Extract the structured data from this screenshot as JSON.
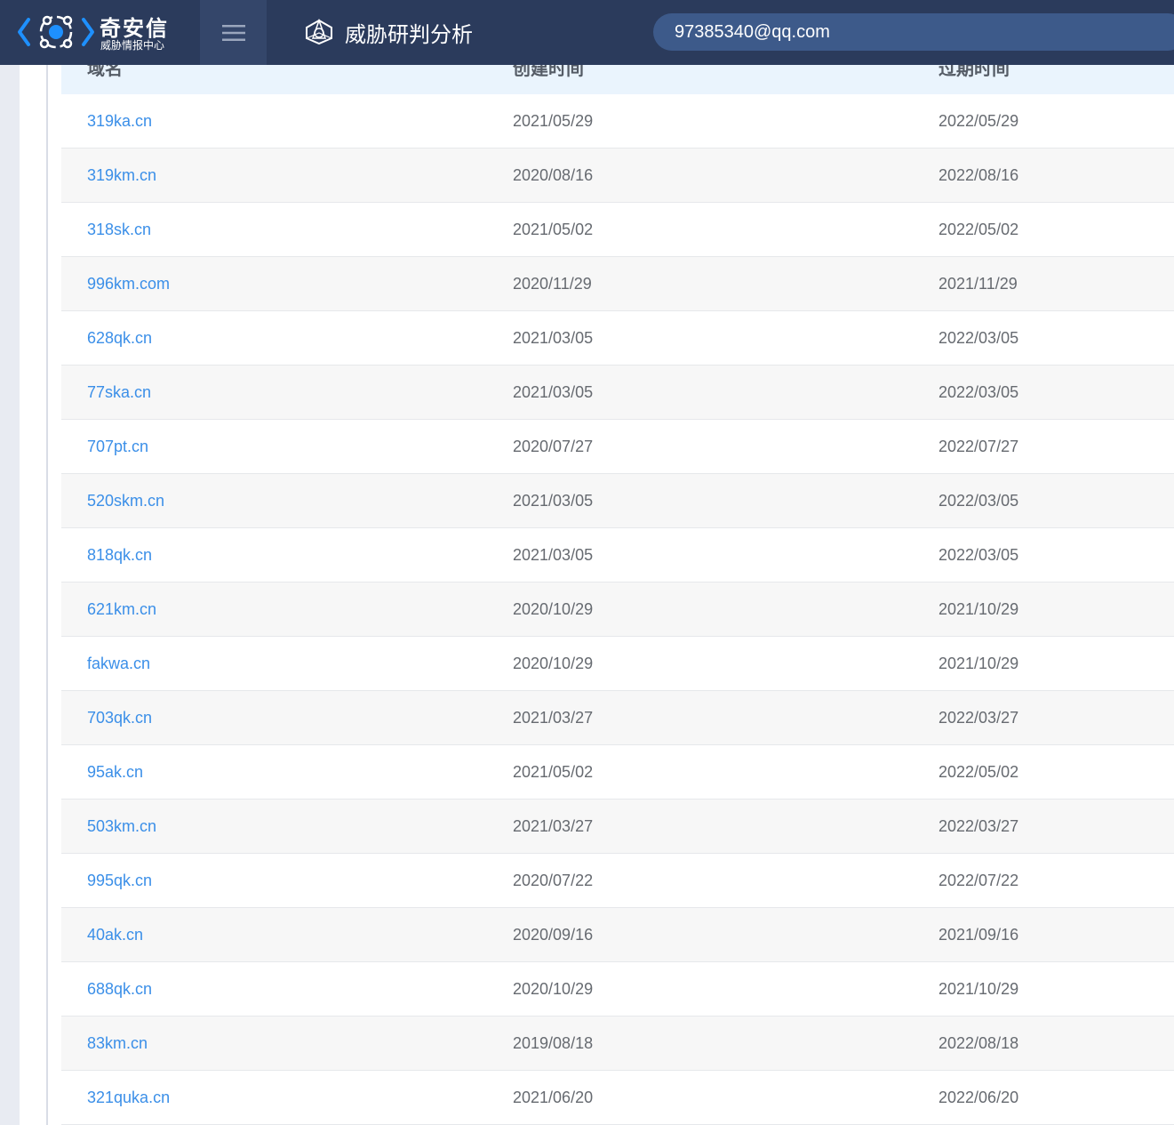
{
  "header": {
    "logo_title": "奇安信",
    "logo_subtitle": "威胁情报中心",
    "page_title": "威胁研判分析",
    "search_value": "97385340@qq.com"
  },
  "table": {
    "columns": [
      "域名",
      "创建时间",
      "过期时间"
    ],
    "rows": [
      {
        "domain": "319ka.cn",
        "created": "2021/05/29",
        "expires": "2022/05/29"
      },
      {
        "domain": "319km.cn",
        "created": "2020/08/16",
        "expires": "2022/08/16"
      },
      {
        "domain": "318sk.cn",
        "created": "2021/05/02",
        "expires": "2022/05/02"
      },
      {
        "domain": "996km.com",
        "created": "2020/11/29",
        "expires": "2021/11/29"
      },
      {
        "domain": "628qk.cn",
        "created": "2021/03/05",
        "expires": "2022/03/05"
      },
      {
        "domain": "77ska.cn",
        "created": "2021/03/05",
        "expires": "2022/03/05"
      },
      {
        "domain": "707pt.cn",
        "created": "2020/07/27",
        "expires": "2022/07/27"
      },
      {
        "domain": "520skm.cn",
        "created": "2021/03/05",
        "expires": "2022/03/05"
      },
      {
        "domain": "818qk.cn",
        "created": "2021/03/05",
        "expires": "2022/03/05"
      },
      {
        "domain": "621km.cn",
        "created": "2020/10/29",
        "expires": "2021/10/29"
      },
      {
        "domain": "fakwa.cn",
        "created": "2020/10/29",
        "expires": "2021/10/29"
      },
      {
        "domain": "703qk.cn",
        "created": "2021/03/27",
        "expires": "2022/03/27"
      },
      {
        "domain": "95ak.cn",
        "created": "2021/05/02",
        "expires": "2022/05/02"
      },
      {
        "domain": "503km.cn",
        "created": "2021/03/27",
        "expires": "2022/03/27"
      },
      {
        "domain": "995qk.cn",
        "created": "2020/07/22",
        "expires": "2022/07/22"
      },
      {
        "domain": "40ak.cn",
        "created": "2020/09/16",
        "expires": "2021/09/16"
      },
      {
        "domain": "688qk.cn",
        "created": "2020/10/29",
        "expires": "2021/10/29"
      },
      {
        "domain": "83km.cn",
        "created": "2019/08/18",
        "expires": "2022/08/18"
      },
      {
        "domain": "321quka.cn",
        "created": "2021/06/20",
        "expires": "2022/06/20"
      }
    ]
  },
  "colors": {
    "topbar": "#2b3b5c",
    "accent": "#1e90ff",
    "link": "#3b8fe8",
    "header_row": "#eaf4fd"
  },
  "icons": {
    "logo": "qianxin-logo-icon",
    "menu": "hamburger-menu-icon",
    "page": "threat-analysis-icon"
  }
}
